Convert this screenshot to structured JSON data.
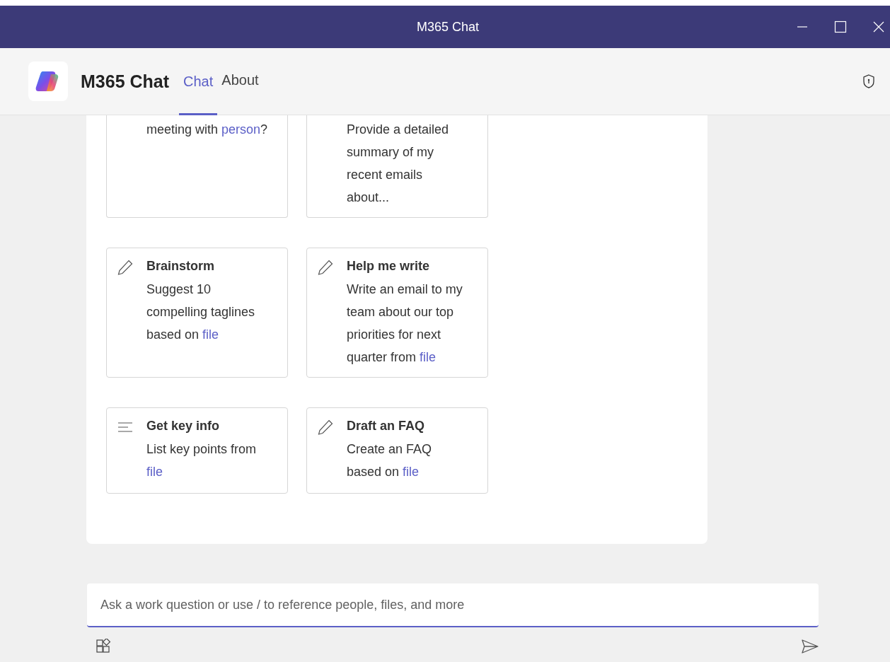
{
  "window": {
    "title": "M365 Chat"
  },
  "app": {
    "name": "M365 Chat"
  },
  "tabs": [
    {
      "label": "Chat",
      "selected": true
    },
    {
      "label": "About",
      "selected": false
    }
  ],
  "cards": [
    {
      "kind": "cut",
      "body": [
        {
          "text": "meeting with "
        },
        {
          "text": "person",
          "kind": "link"
        },
        {
          "text": "?"
        }
      ]
    },
    {
      "kind": "cut",
      "body": [
        {
          "text": "Provide a detailed summary of my recent emails about..."
        }
      ]
    },
    {
      "kind": "pencil",
      "title": "Brainstorm",
      "body": [
        {
          "text": "Suggest 10 compelling taglines based on "
        },
        {
          "text": "file",
          "kind": "link"
        }
      ]
    },
    {
      "kind": "pencil",
      "title": "Help me write",
      "body": [
        {
          "text": "Write an email to my team about our top priorities for next quarter from "
        },
        {
          "text": "file",
          "kind": "link"
        }
      ]
    },
    {
      "kind": "lines",
      "title": "Get key info",
      "body": [
        {
          "text": "List key points from "
        },
        {
          "text": "file",
          "kind": "link"
        }
      ]
    },
    {
      "kind": "pencil",
      "title": "Draft an FAQ",
      "body": [
        {
          "text": "Create an FAQ based on "
        },
        {
          "text": "file",
          "kind": "link"
        }
      ]
    }
  ],
  "composer": {
    "placeholder": "Ask a work question or use / to reference people, files, and more"
  }
}
